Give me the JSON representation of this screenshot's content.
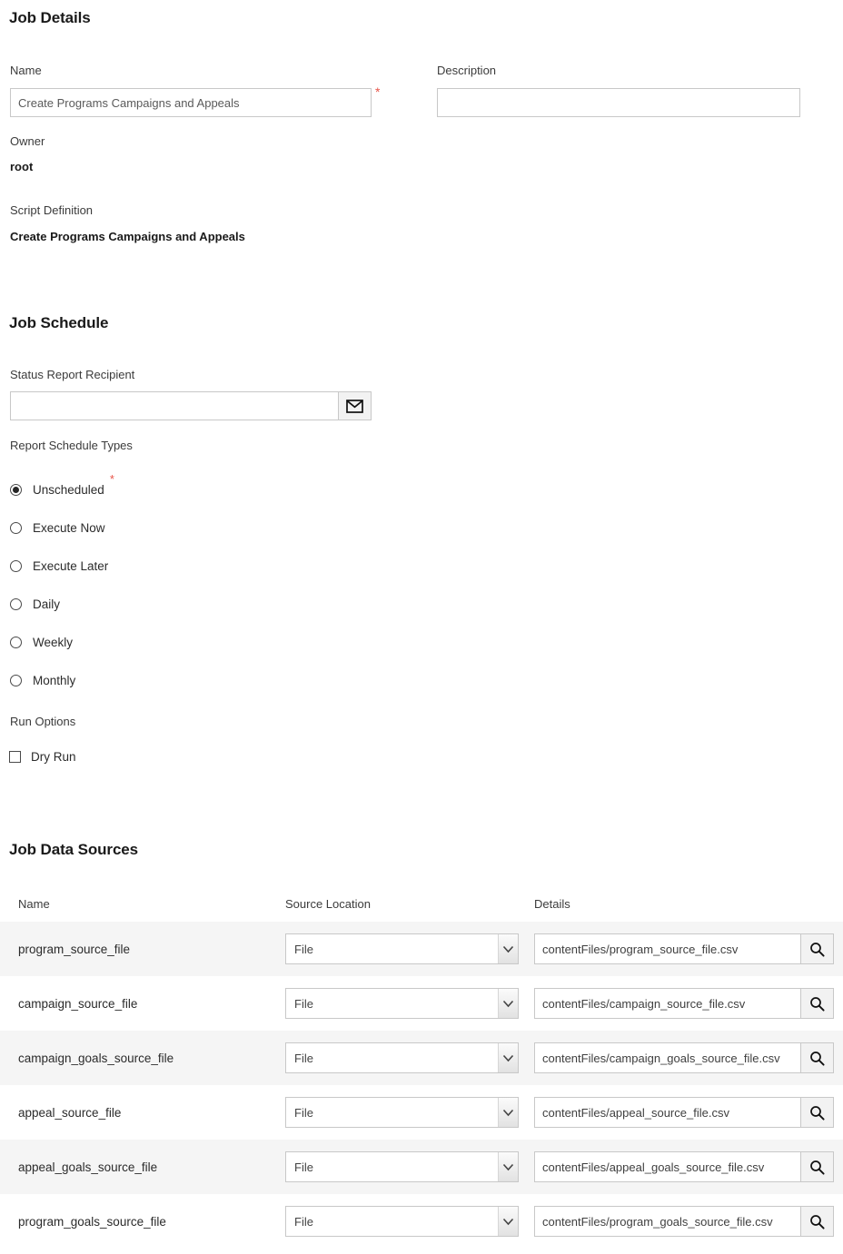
{
  "job_details": {
    "title": "Job Details",
    "name_label": "Name",
    "name_value": "Create Programs Campaigns and Appeals",
    "name_required_mark": "*",
    "description_label": "Description",
    "description_value": "",
    "description_placeholder": "",
    "owner_label": "Owner",
    "owner_value": "root",
    "script_definition_label": "Script Definition",
    "script_definition_value": "Create Programs Campaigns and Appeals"
  },
  "job_schedule": {
    "title": "Job Schedule",
    "status_report_recipient_label": "Status Report Recipient",
    "status_report_recipient_value": "",
    "status_report_recipient_placeholder": "",
    "email_icon": "envelope-icon",
    "report_schedule_types_label": "Report Schedule Types",
    "report_schedule_required_mark": "*",
    "schedule_options": [
      {
        "label": "Unscheduled",
        "selected": true
      },
      {
        "label": "Execute Now",
        "selected": false
      },
      {
        "label": "Execute Later",
        "selected": false
      },
      {
        "label": "Daily",
        "selected": false
      },
      {
        "label": "Weekly",
        "selected": false
      },
      {
        "label": "Monthly",
        "selected": false
      }
    ],
    "run_options_label": "Run Options",
    "dry_run_label": "Dry Run",
    "dry_run_checked": false
  },
  "job_data_sources": {
    "title": "Job Data Sources",
    "columns": [
      "Name",
      "Source Location",
      "Details"
    ],
    "search_icon": "search-icon",
    "chevron_icon": "chevron-down-icon",
    "rows": [
      {
        "name": "program_source_file",
        "source_location": "File",
        "details": "contentFiles/program_source_file.csv"
      },
      {
        "name": "campaign_source_file",
        "source_location": "File",
        "details": "contentFiles/campaign_source_file.csv"
      },
      {
        "name": "campaign_goals_source_file",
        "source_location": "File",
        "details": "contentFiles/campaign_goals_source_file.csv"
      },
      {
        "name": "appeal_source_file",
        "source_location": "File",
        "details": "contentFiles/appeal_source_file.csv"
      },
      {
        "name": "appeal_goals_source_file",
        "source_location": "File",
        "details": "contentFiles/appeal_goals_source_file.csv"
      },
      {
        "name": "program_goals_source_file",
        "source_location": "File",
        "details": "contentFiles/program_goals_source_file.csv"
      }
    ]
  },
  "colors": {
    "required_asterisk": "#e8554a",
    "row_stripe": "#f5f5f5",
    "border": "#c8c8c8",
    "heading": "#1a1a1a"
  }
}
